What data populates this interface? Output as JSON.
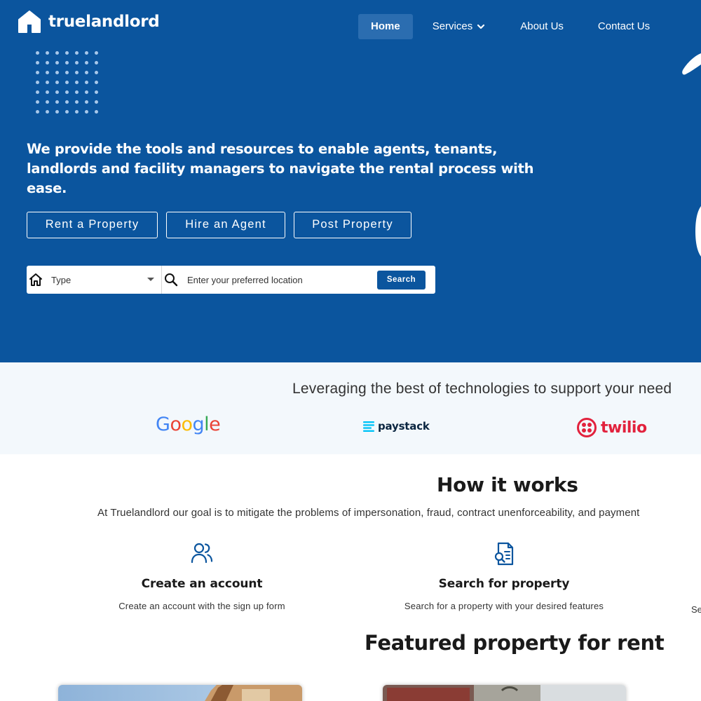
{
  "brand": {
    "name": "truelandlord"
  },
  "nav": {
    "items": [
      {
        "label": "Home"
      },
      {
        "label": "Services"
      },
      {
        "label": "About Us"
      },
      {
        "label": "Contact Us"
      }
    ]
  },
  "hero": {
    "headline": "We provide the tools and resources to enable agents, tenants, landlords and facility managers to navigate the rental process with ease.",
    "buttons": [
      {
        "label": "Rent a Property"
      },
      {
        "label": "Hire an Agent"
      },
      {
        "label": "Post Property"
      }
    ],
    "search": {
      "type_label": "Type",
      "location_placeholder": "Enter your preferred location",
      "button_label": "Search"
    }
  },
  "partners": {
    "title": "Leveraging the best of technologies to support your need",
    "logos": [
      {
        "name": "Google",
        "letters": [
          "G",
          "o",
          "o",
          "g",
          "l",
          "e"
        ]
      },
      {
        "name": "paystack"
      },
      {
        "name": "twilio"
      }
    ]
  },
  "how": {
    "title": "How it works",
    "subtitle": "At Truelandlord our goal is to mitigate the problems of impersonation, fraud, contract unenforceability, and payment",
    "steps": [
      {
        "icon": "users-icon",
        "title": "Create an account",
        "desc": "Create an account with the sign up form"
      },
      {
        "icon": "document-search-icon",
        "title": "Search for property",
        "desc": "Search for a property with your desired features"
      },
      {
        "desc_fragment": "Se"
      }
    ]
  },
  "featured": {
    "title": "Featured property for rent"
  },
  "colors": {
    "hero_bg": "#0b559e",
    "nav_active_bg": "#2b6db0",
    "partners_bg": "#f3f8fc",
    "search_button": "#0b559e",
    "twilio_red": "#e2223d"
  }
}
